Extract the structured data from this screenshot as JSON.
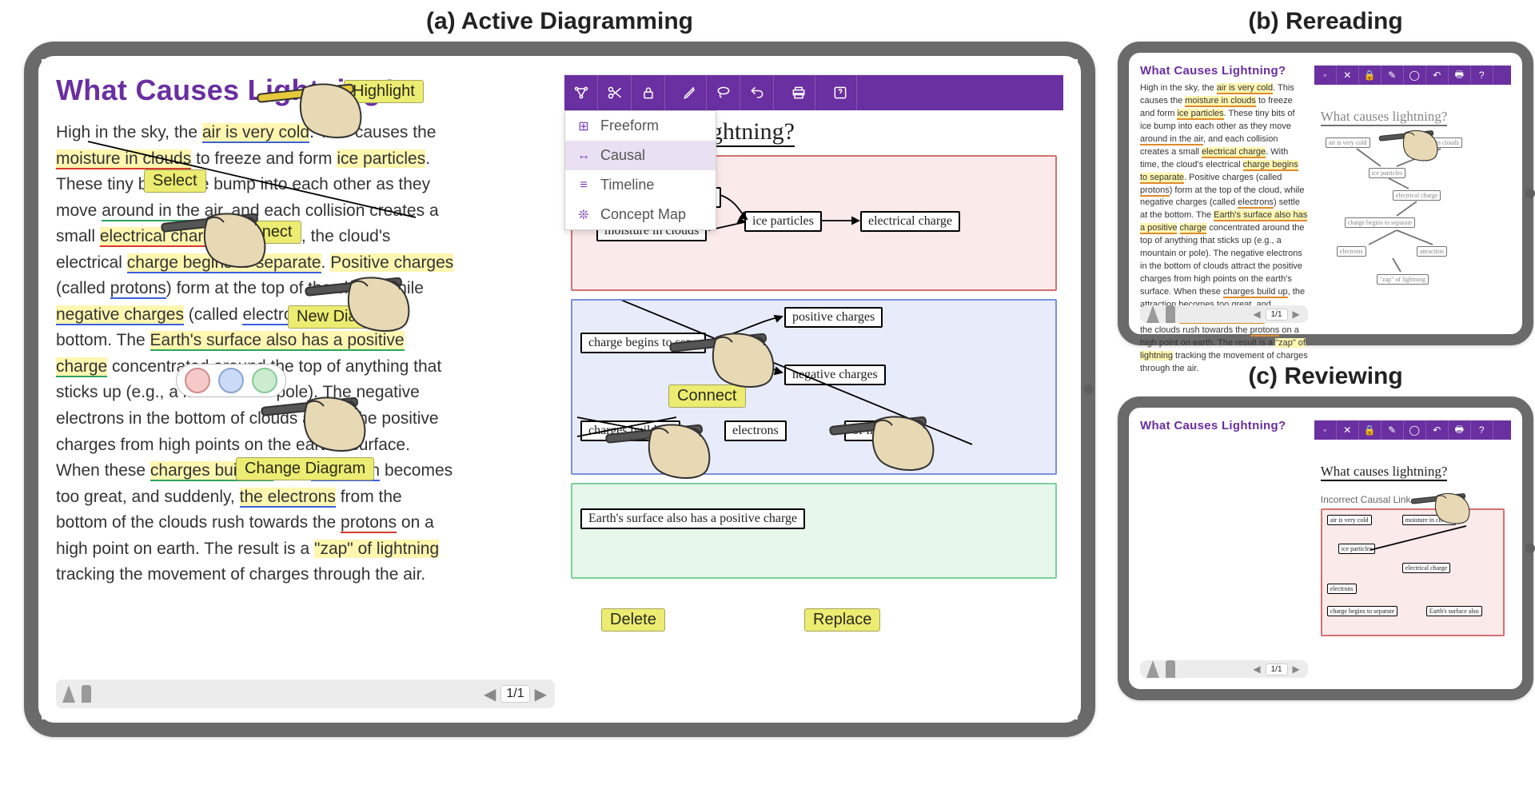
{
  "captions": {
    "a": "(a) Active Diagramming",
    "b": "(b) Rereading",
    "c": "(c) Reviewing"
  },
  "passage_title": "What Causes Lightning?",
  "passage_text": "High in the sky, the air is very cold. This causes the moisture in clouds to freeze and form ice particles. These tiny bits of ice bump into each other as they move around in the air, and each collision creates a small electrical charge. With time, the cloud's electrical charge begins to separate. Positive charges (called protons) form at the top of the cloud, while negative charges (called electrons) settle at the bottom. The Earth's surface also has a positive charge concentrated around the top of anything that sticks up (e.g., a mountain or pole). The negative electrons in the bottom of clouds attract the positive charges from high points on the earth's surface. When these charges build up, the attraction becomes too great, and suddenly, the electrons from the bottom of the clouds rush towards the protons on a high point on earth. The result is a \"zap\" of lightning tracking the movement of charges through the air.",
  "pager": {
    "page": "1/1"
  },
  "tags": {
    "highlight": "Highlight",
    "select": "Select",
    "connect": "Connect",
    "new_diagram": "New Diagram",
    "change_diagram": "Change Diagram",
    "delete": "Delete",
    "replace": "Replace"
  },
  "dropdown": {
    "freeform": "Freeform",
    "causal": "Causal",
    "timeline": "Timeline",
    "concept_map": "Concept Map"
  },
  "canvas_title": "What causes lightning?",
  "nodes": {
    "air_cold": "air is very cold",
    "ice": "ice particles",
    "moisture": "moisture in clouds",
    "elec": "electrical charge",
    "sep": "charge begins to sepa",
    "pos": "positive charges",
    "neg": "negative charges",
    "electrons": "electrons",
    "build": "charges build up",
    "zap": "of lightning",
    "earth": "Earth's surface also has a positive charge"
  },
  "reviewing_feedback": "Incorrect Causal Link",
  "chart_data": {
    "type": "diagram",
    "conditions": [
      "Active Diagramming",
      "Rereading",
      "Reviewing"
    ],
    "concept_nodes": [
      "air is very cold",
      "moisture in clouds",
      "ice particles",
      "electrical charge",
      "charge begins to separate",
      "positive charges",
      "negative charges",
      "electrons",
      "charges build up",
      "zap of lightning",
      "Earth's surface also has a positive charge"
    ],
    "causal_links": [
      [
        "air is very cold",
        "ice particles"
      ],
      [
        "moisture in clouds",
        "ice particles"
      ],
      [
        "ice particles",
        "electrical charge"
      ],
      [
        "electrical charge",
        "charge begins to separate"
      ],
      [
        "charge begins to separate",
        "positive charges"
      ],
      [
        "charge begins to separate",
        "negative charges"
      ],
      [
        "negative charges",
        "electrons"
      ],
      [
        "charges build up",
        "zap of lightning"
      ]
    ],
    "diagram_modes": [
      "Freeform",
      "Causal",
      "Timeline",
      "Concept Map"
    ],
    "interaction_labels": [
      "Highlight",
      "Select",
      "Connect",
      "New Diagram",
      "Change Diagram",
      "Delete",
      "Replace"
    ]
  }
}
